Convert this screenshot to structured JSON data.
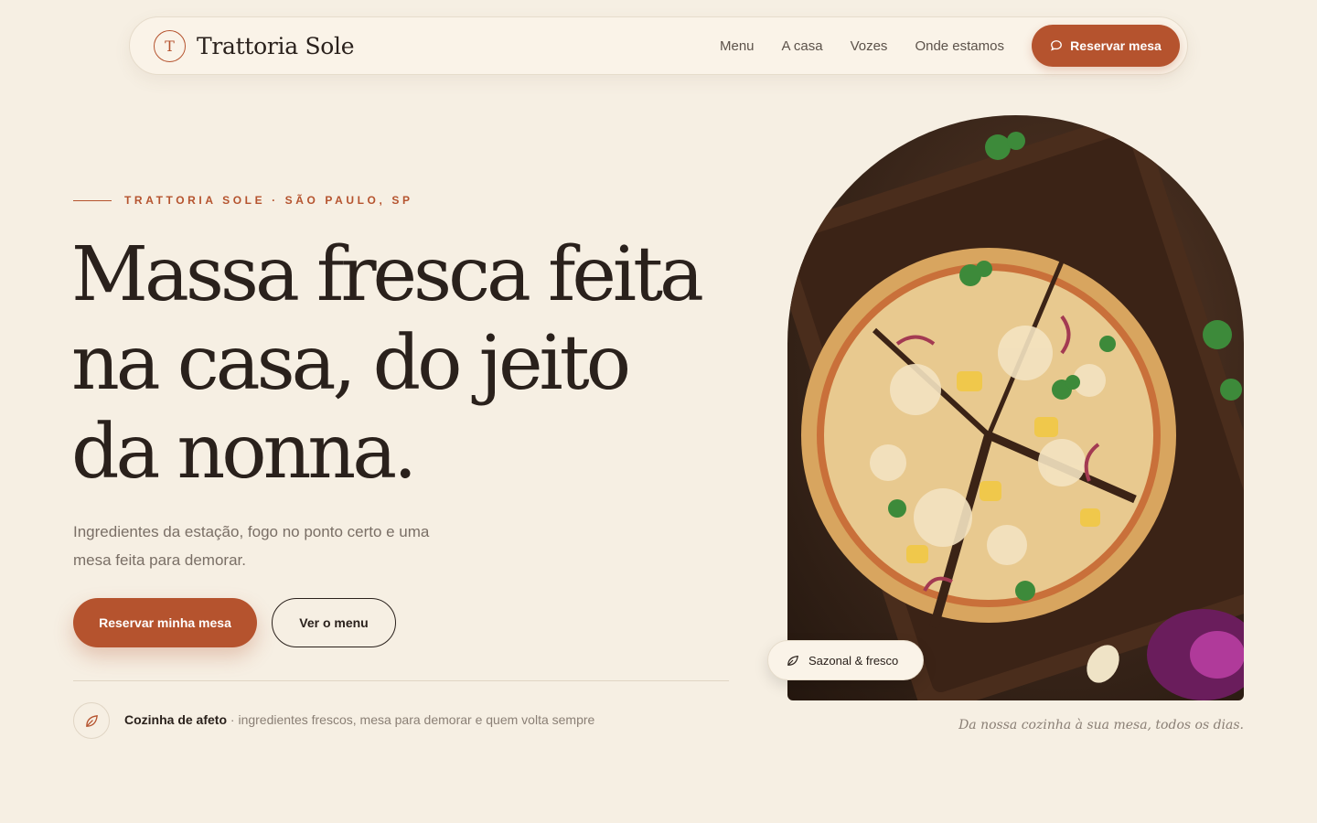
{
  "brand": {
    "mark": "T",
    "name": "Trattoria Sole"
  },
  "nav": {
    "links": [
      "Menu",
      "A casa",
      "Vozes",
      "Onde estamos"
    ],
    "cta_label": "Reservar mesa"
  },
  "hero": {
    "eyebrow": "TRATTORIA SOLE · SÃO PAULO, SP",
    "title": "Massa fresca feita na casa, do jeito da nonna.",
    "subtitle": "Ingredientes da estação, fogo no ponto certo e uma mesa feita para demorar.",
    "primary_cta": "Reservar minha mesa",
    "secondary_cta": "Ver o menu",
    "feature_title": "Cozinha de afeto",
    "feature_text": " · ingredientes frescos, mesa para demorar e quem volta sempre"
  },
  "media": {
    "badge": "Sazonal & fresco",
    "caption": "Da nossa cozinha à sua mesa, todos os dias."
  },
  "icons": {
    "chat": "chat-bubble-icon",
    "leaf": "leaf-icon"
  },
  "colors": {
    "accent": "#b5532e",
    "background": "#f6efe3",
    "text": "#2a211c",
    "muted": "#7a6f66"
  }
}
